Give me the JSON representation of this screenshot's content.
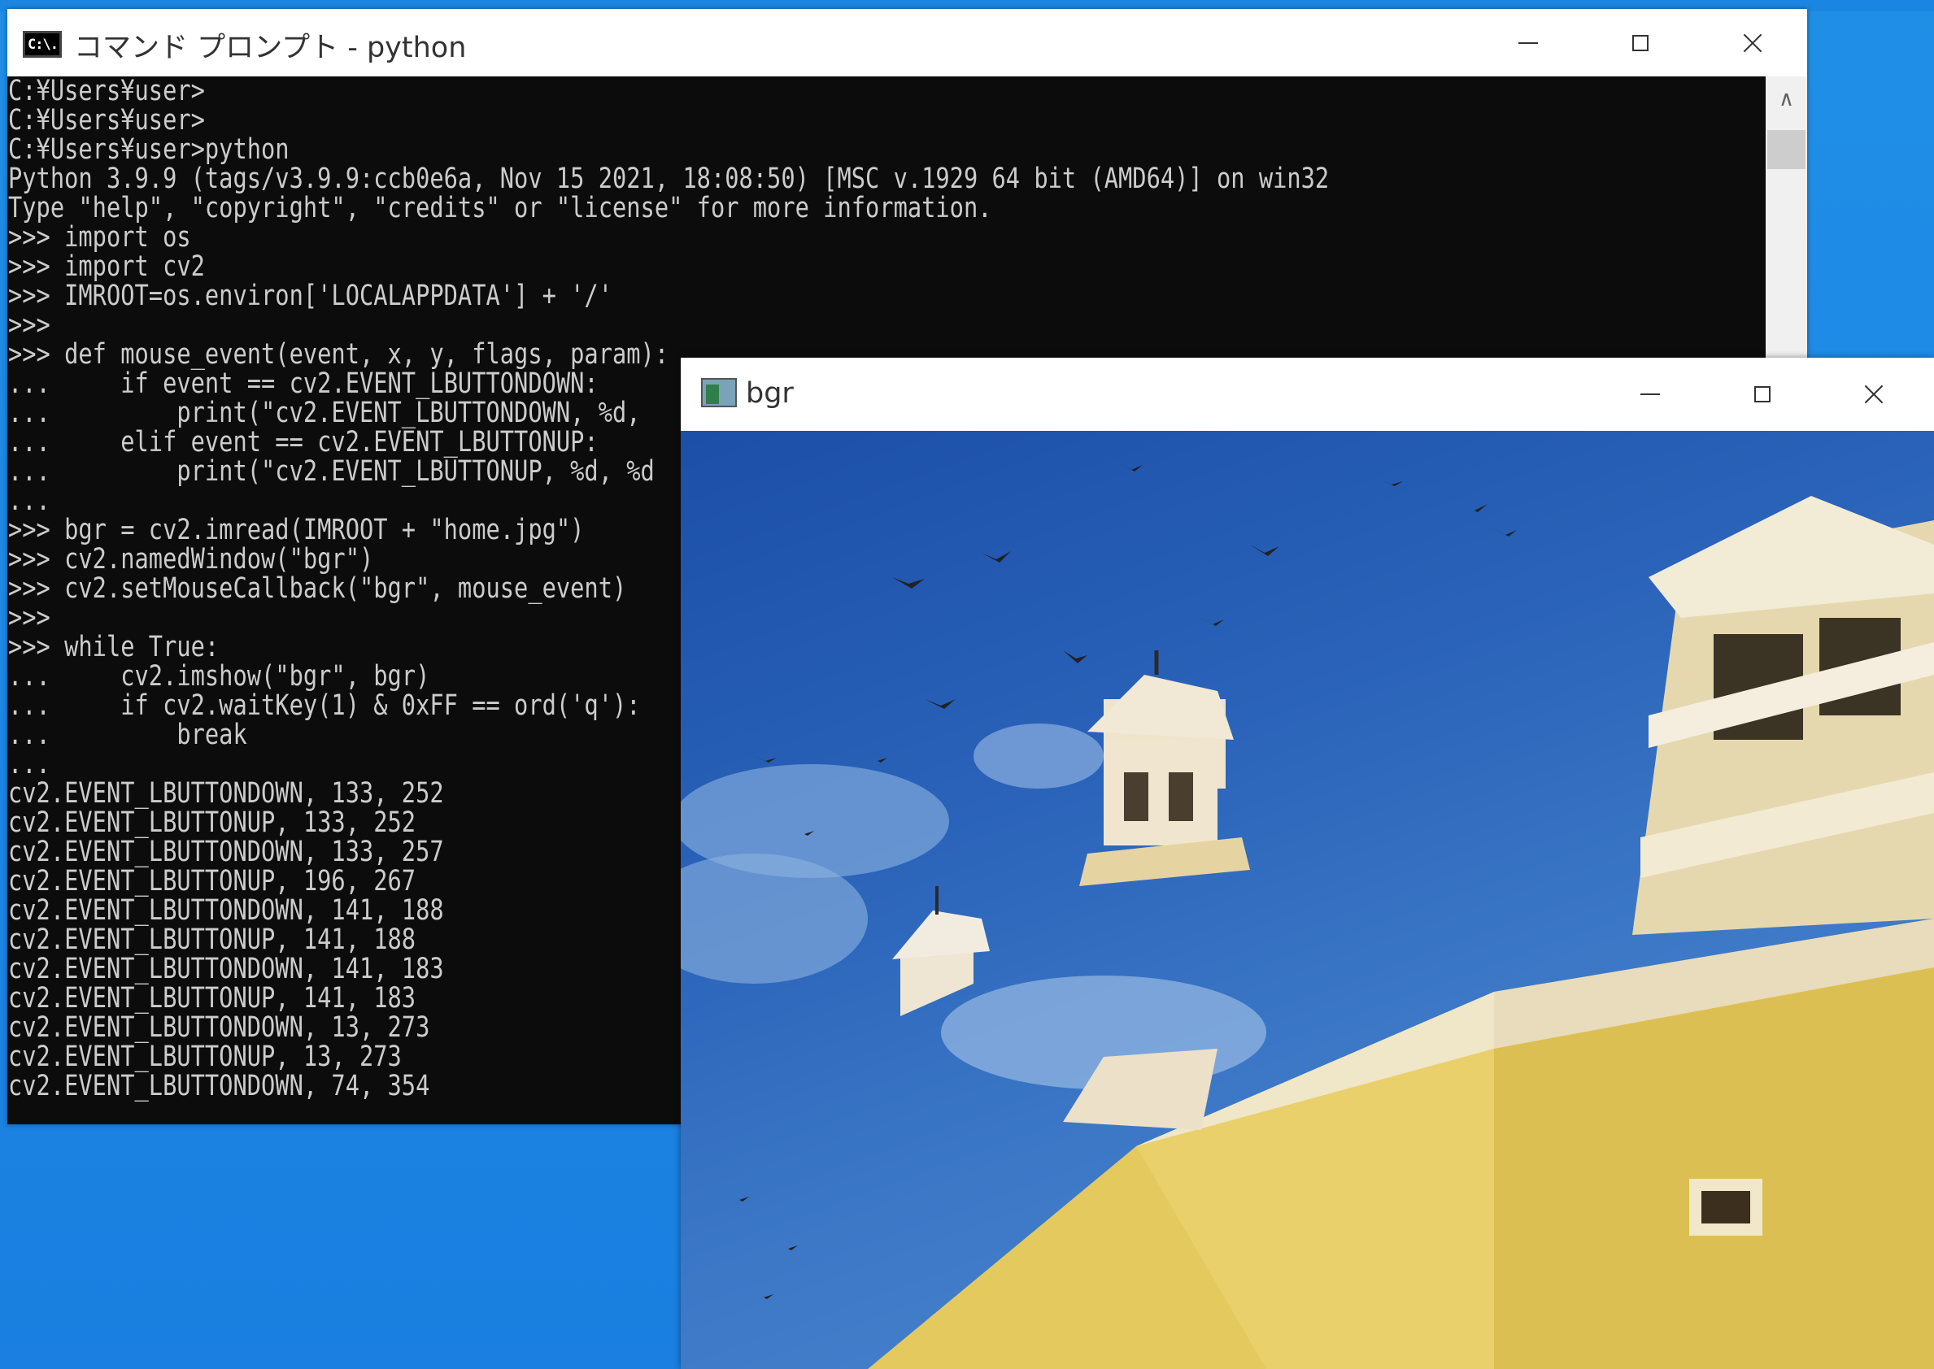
{
  "console_window": {
    "title": "コマンド プロンプト - python",
    "icon_text": "C:\\.",
    "lines": [
      "C:¥Users¥user>",
      "C:¥Users¥user>",
      "C:¥Users¥user>python",
      "Python 3.9.9 (tags/v3.9.9:ccb0e6a, Nov 15 2021, 18:08:50) [MSC v.1929 64 bit (AMD64)] on win32",
      "Type \"help\", \"copyright\", \"credits\" or \"license\" for more information.",
      ">>> import os",
      ">>> import cv2",
      ">>> IMROOT=os.environ['LOCALAPPDATA'] + '/'",
      ">>>",
      ">>> def mouse_event(event, x, y, flags, param):",
      "...     if event == cv2.EVENT_LBUTTONDOWN:",
      "...         print(\"cv2.EVENT_LBUTTONDOWN, %d,",
      "...     elif event == cv2.EVENT_LBUTTONUP:",
      "...         print(\"cv2.EVENT_LBUTTONUP, %d, %d",
      "...",
      ">>> bgr = cv2.imread(IMROOT + \"home.jpg\")",
      ">>> cv2.namedWindow(\"bgr\")",
      ">>> cv2.setMouseCallback(\"bgr\", mouse_event)",
      ">>>",
      ">>> while True:",
      "...     cv2.imshow(\"bgr\", bgr)",
      "...     if cv2.waitKey(1) & 0xFF == ord('q'):",
      "...         break",
      "...",
      "cv2.EVENT_LBUTTONDOWN, 133, 252",
      "cv2.EVENT_LBUTTONUP, 133, 252",
      "cv2.EVENT_LBUTTONDOWN, 133, 257",
      "cv2.EVENT_LBUTTONUP, 196, 267",
      "cv2.EVENT_LBUTTONDOWN, 141, 188",
      "cv2.EVENT_LBUTTONUP, 141, 188",
      "cv2.EVENT_LBUTTONDOWN, 141, 183",
      "cv2.EVENT_LBUTTONUP, 141, 183",
      "cv2.EVENT_LBUTTONDOWN, 13, 273",
      "cv2.EVENT_LBUTTONUP, 13, 273",
      "cv2.EVENT_LBUTTONDOWN, 74, 354"
    ]
  },
  "image_window": {
    "title": "bgr"
  },
  "colors": {
    "desktop": "#1e88e5",
    "console_bg": "#0c0c0c",
    "console_text": "#cccccc",
    "titlebar": "#ffffff"
  }
}
